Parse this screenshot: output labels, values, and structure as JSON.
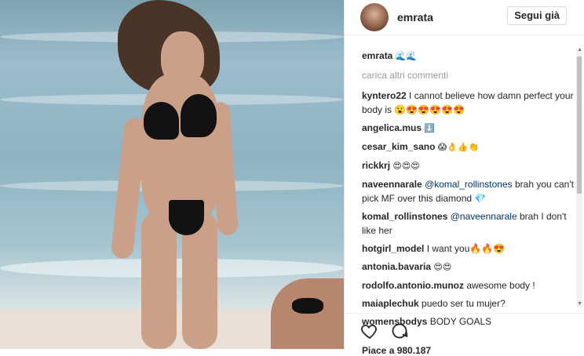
{
  "post": {
    "username": "emrata",
    "follow_label": "Segui già",
    "caption_user": "emrata",
    "caption_text": "🌊🌊",
    "load_more": "carica altri commenti",
    "likes_partial": "Piace a 980.187"
  },
  "comments": [
    {
      "user": "kyntero22",
      "text": "I cannot believe how damn perfect your body is 😮😍😍😍😍😍"
    },
    {
      "user": "angelica.mus",
      "text": "⬇️"
    },
    {
      "user": "cesar_kim_sano",
      "text": "😱👌👍👏"
    },
    {
      "user": "rickkrj",
      "text": "😍😍😍"
    },
    {
      "user": "naveennarale",
      "mention": "@komal_rollinstones",
      "text": "brah you can't pick MF over this diamond 💎"
    },
    {
      "user": "komal_rollinstones",
      "mention": "@naveennarale",
      "text": "brah I don't like her"
    },
    {
      "user": "hotgirl_model",
      "text": "I want you🔥🔥😍"
    },
    {
      "user": "antonia.bavaria",
      "text": "😍😍"
    },
    {
      "user": "rodolfo.antonio.munoz",
      "text": "awesome body !"
    },
    {
      "user": "maiaplechuk",
      "text": "puedo ser tu mujer?"
    },
    {
      "user": "womensbodys",
      "text": "BODY GOALS"
    }
  ],
  "icons": {
    "like": "heart-icon",
    "comment": "comment-icon"
  },
  "colors": {
    "text": "#262626",
    "muted": "#999999",
    "mention": "#003569",
    "border": "#efefef"
  }
}
